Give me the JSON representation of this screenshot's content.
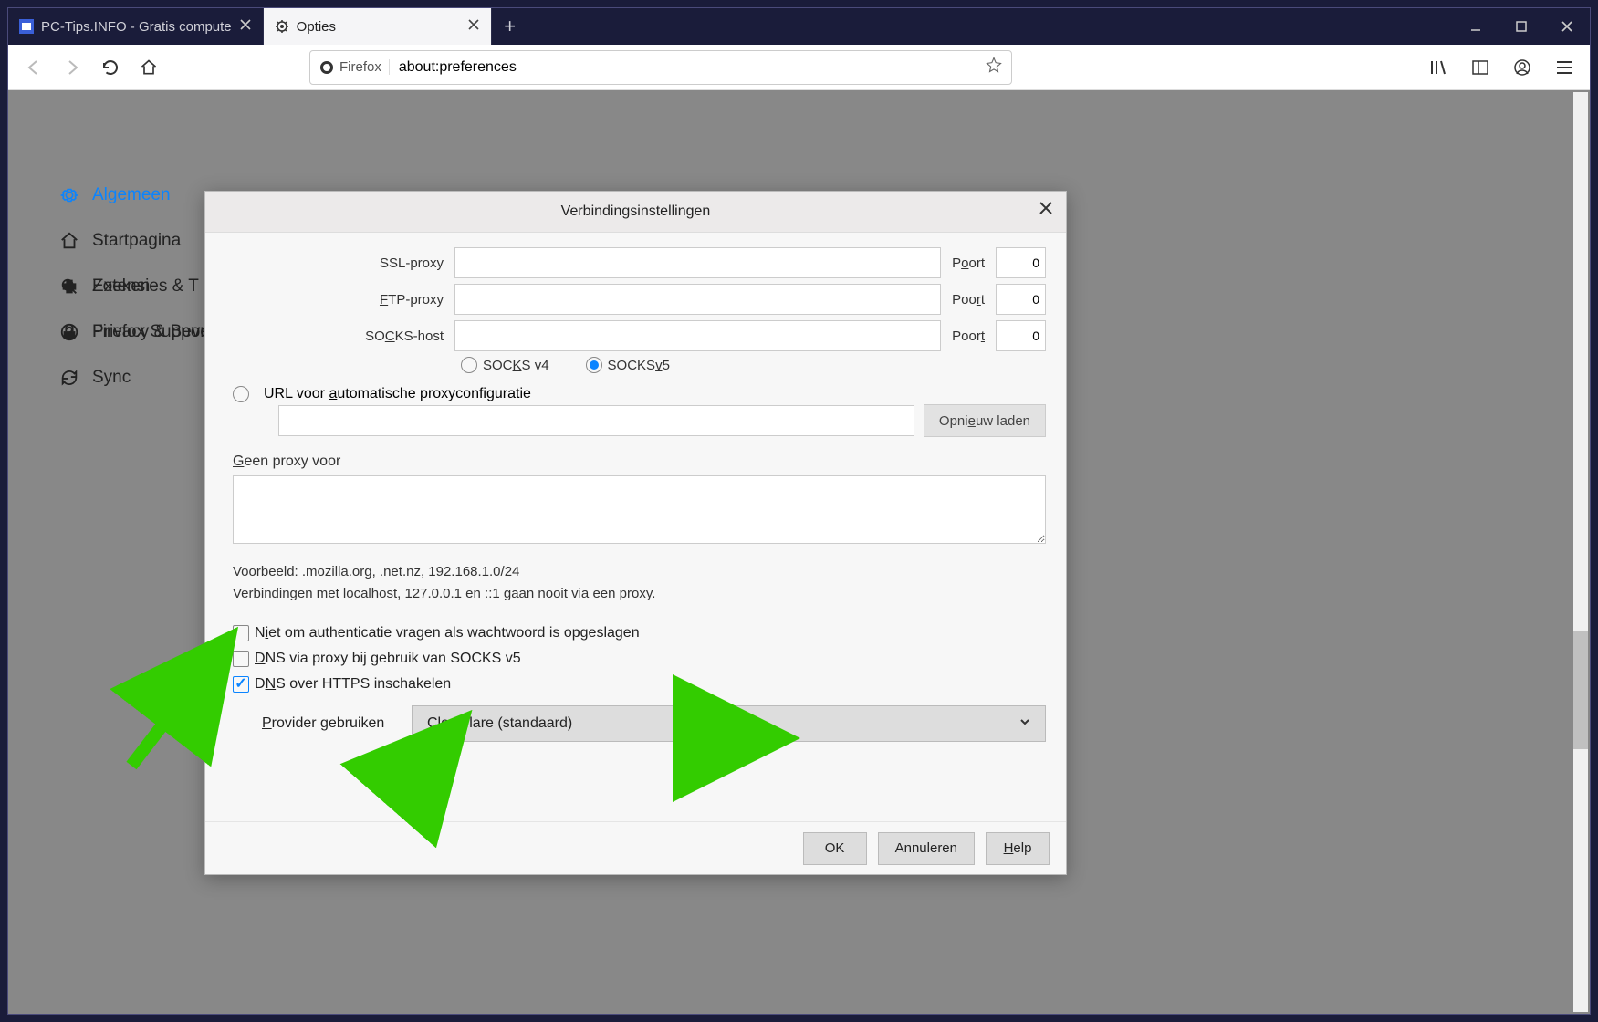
{
  "tabs": [
    {
      "title": "PC-Tips.INFO - Gratis compute"
    },
    {
      "title": "Opties"
    }
  ],
  "urlbar": {
    "identity": "Firefox",
    "url": "about:preferences"
  },
  "sidebar": {
    "items": [
      {
        "label": "Algemeen"
      },
      {
        "label": "Startpagina"
      },
      {
        "label": "Zoeken"
      },
      {
        "label": "Privacy & Beve"
      },
      {
        "label": "Sync"
      }
    ],
    "bottom": [
      {
        "label": "Extensies & T"
      },
      {
        "label": "Firefox Support"
      }
    ]
  },
  "dialog": {
    "title": "Verbindingsinstellingen",
    "proxies": {
      "ssl": {
        "label": "SSL-proxy",
        "port_label": "Poort",
        "port": "0"
      },
      "ftp": {
        "label": "FTP-proxy",
        "port_label": "Poort",
        "port": "0"
      },
      "socks": {
        "label": "SOCKS-host",
        "port_label": "Poort",
        "port": "0"
      }
    },
    "socks_v4": "SOCKS v4",
    "socks_v5": "SOCKS v5",
    "auto_url": "URL voor automatische proxyconfiguratie",
    "reload": "Opnieuw laden",
    "no_proxy_label": "Geen proxy voor",
    "example": "Voorbeeld: .mozilla.org, .net.nz, 192.168.1.0/24",
    "localhost_note": "Verbindingen met localhost, 127.0.0.1 en ::1 gaan nooit via een proxy.",
    "chk_noauth": "Niet om authenticatie vragen als wachtwoord is opgeslagen",
    "chk_dns_socks": "DNS via proxy bij gebruik van SOCKS v5",
    "chk_dns_https": "DNS over HTTPS inschakelen",
    "provider_label": "Provider gebruiken",
    "provider_value": "Cloudflare (standaard)",
    "buttons": {
      "ok": "OK",
      "cancel": "Annuleren",
      "help": "Help"
    }
  }
}
